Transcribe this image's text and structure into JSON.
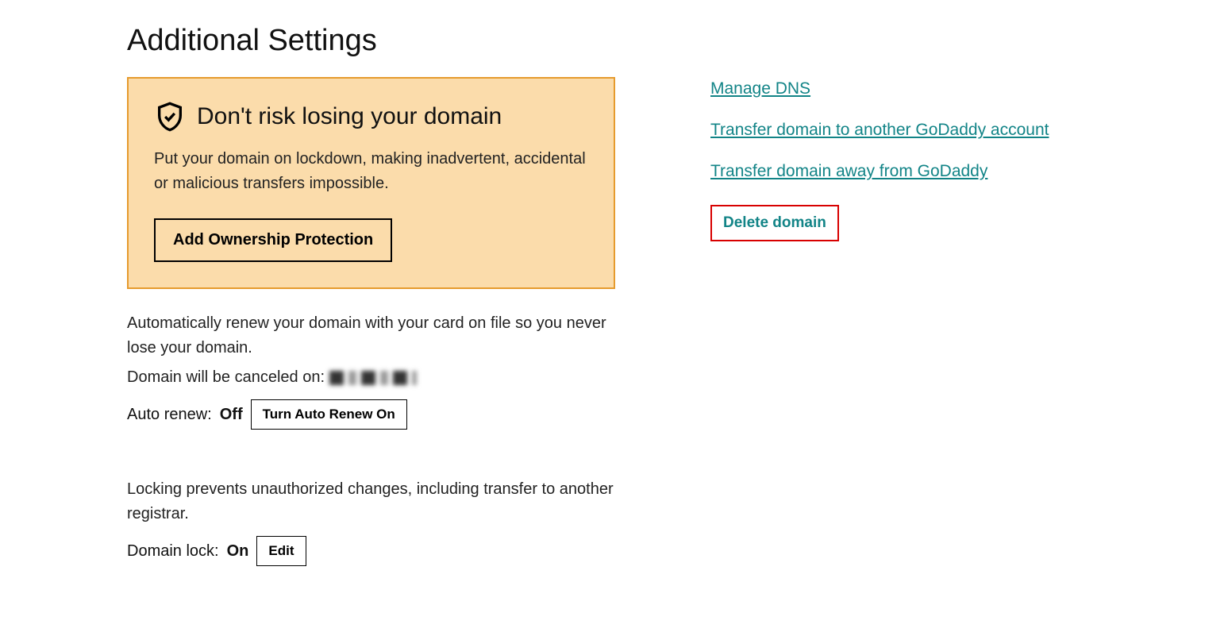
{
  "heading": "Additional Settings",
  "promo": {
    "title": "Don't risk losing your domain",
    "desc": "Put your domain on lockdown, making inadvertent, accidental or malicious transfers impossible.",
    "button": "Add Ownership Protection"
  },
  "autorenew": {
    "desc": "Automatically renew your domain with your card on file so you never lose your domain.",
    "cancel_prefix": "Domain will be canceled on:",
    "label": "Auto renew:",
    "status": "Off",
    "button": "Turn Auto Renew On"
  },
  "lock": {
    "desc": "Locking prevents unauthorized changes, including transfer to another registrar.",
    "label": "Domain lock:",
    "status": "On",
    "button": "Edit"
  },
  "links": {
    "manage_dns": "Manage DNS",
    "transfer_another": "Transfer domain to another GoDaddy account",
    "transfer_away": "Transfer domain away from GoDaddy",
    "delete": "Delete domain"
  }
}
